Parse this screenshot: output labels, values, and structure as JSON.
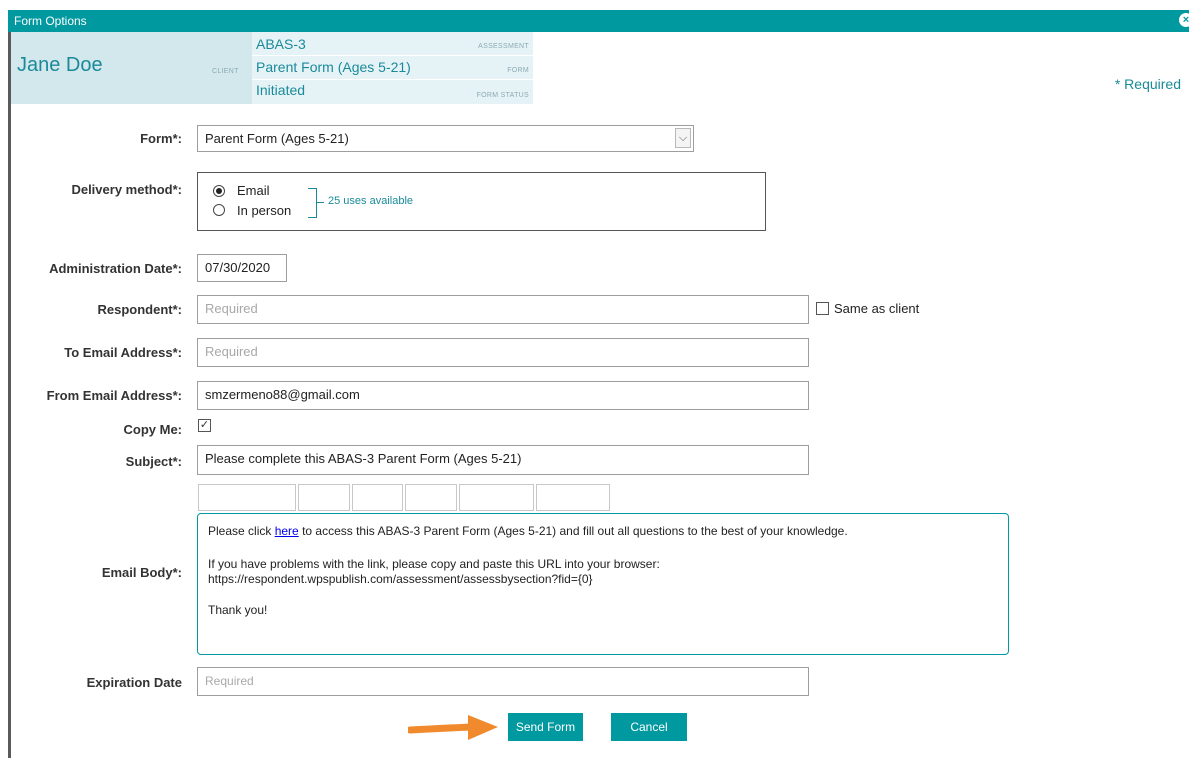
{
  "window": {
    "title": "Form Options"
  },
  "header": {
    "client_name": "Jane Doe",
    "client_tag": "CLIENT",
    "assessment": "ABAS-3",
    "assessment_tag": "ASSESSMENT",
    "form": "Parent Form (Ages 5-21)",
    "form_tag": "FORM",
    "status": "Initiated",
    "status_tag": "FORM STATUS",
    "required_note": "* Required"
  },
  "form_field": {
    "label": "Form*:",
    "value": "Parent Form (Ages 5-21)"
  },
  "delivery": {
    "label": "Delivery method*:",
    "options": [
      "Email",
      "In person"
    ],
    "selected": "Email",
    "uses_available": "25 uses available"
  },
  "admin_date": {
    "label": "Administration Date*:",
    "value": "07/30/2020"
  },
  "respondent": {
    "label": "Respondent*:",
    "placeholder": "Required",
    "same_as_client": "Same as client"
  },
  "to_email": {
    "label": "To Email Address*:",
    "placeholder": "Required"
  },
  "from_email": {
    "label": "From Email Address*:",
    "value": "smzermeno88@gmail.com"
  },
  "copy_me": {
    "label": "Copy Me:",
    "checked": true
  },
  "subject": {
    "label": "Subject*:",
    "value": "Please complete this ABAS-3 Parent Form (Ages 5-21)"
  },
  "email_body": {
    "label": "Email Body*:",
    "line1_before": "Please click ",
    "line1_link": "here",
    "line1_after": " to access this ABAS-3 Parent Form (Ages 5-21) and fill out all questions to the best of your knowledge.",
    "line2": "If you have problems with the link, please copy and paste this URL into your browser:",
    "line3": "https://respondent.wpspublish.com/assessment/assessbysection?fid={0}",
    "line4": "Thank you!"
  },
  "expiration": {
    "label": "Expiration Date",
    "placeholder": "Required"
  },
  "buttons": {
    "send": "Send Form",
    "cancel": "Cancel"
  },
  "colors": {
    "accent": "#0099a0",
    "arrow": "#f08a2c"
  }
}
